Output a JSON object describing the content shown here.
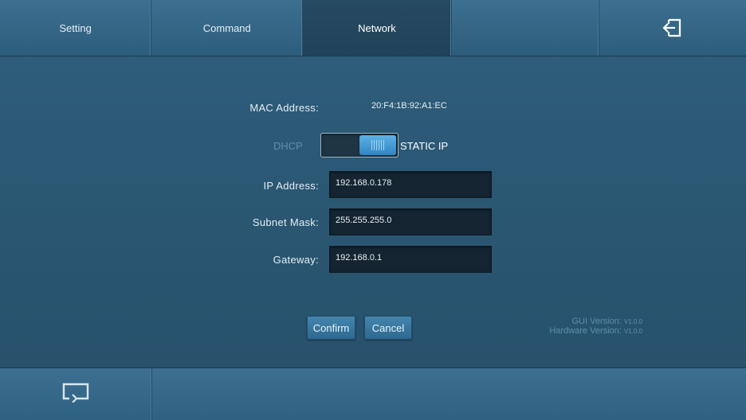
{
  "tabs": {
    "setting": "Setting",
    "command": "Command",
    "network": "Network",
    "empty": ""
  },
  "network": {
    "mac_label": "MAC Address:",
    "mac_value": "20:F4:1B:92:A1:EC",
    "dhcp_label": "DHCP",
    "static_label": "STATIC IP",
    "mode": "STATIC IP",
    "ip_label": "IP Address:",
    "ip_value": "192.168.0.178",
    "subnet_label": "Subnet Mask:",
    "subnet_value": "255.255.255.0",
    "gateway_label": "Gateway:",
    "gateway_value": "192.168.0.1"
  },
  "buttons": {
    "confirm": "Confirm",
    "cancel": "Cancel"
  },
  "version": {
    "gui_label": "GUI Version:",
    "gui_value": "V1.0.0",
    "hw_label": "Hardware Version:",
    "hw_value": "V1.0.0"
  },
  "icons": {
    "exit": "exit-icon",
    "back": "return-icon"
  },
  "colors": {
    "accent": "#2e86c4",
    "active_tab": "#264a61",
    "muted_text": "#5e8eae"
  }
}
